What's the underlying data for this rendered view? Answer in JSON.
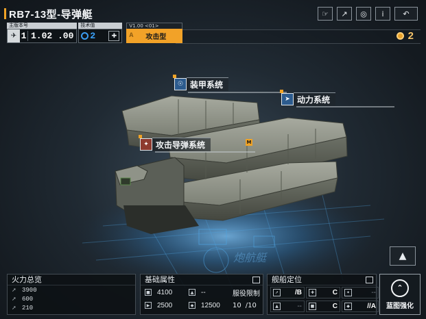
{
  "header": {
    "title": "RB7-13型-导弹艇",
    "icons": [
      "share-cursor-icon",
      "export-icon",
      "view-eye-icon",
      "info-icon",
      "back-icon"
    ]
  },
  "info": {
    "version_label": "主版本号",
    "version_major": "1",
    "version_minor": "1.02 .00",
    "tech_label": "技术值",
    "tech_value": "2",
    "type_tag": "V1.00 <01>",
    "type_letter": "A",
    "type_text": "攻击型"
  },
  "currency": {
    "value": "2",
    "icon": "coin-icon"
  },
  "systems": {
    "armor": "装甲系统",
    "power": "动力系统",
    "missile": "攻击导弹系统",
    "missile_badge": "M"
  },
  "watermark": "炮航艇",
  "fire_panel": {
    "title": "火力总览",
    "rows": [
      {
        "value": "3900"
      },
      {
        "value": "600"
      },
      {
        "value": "210"
      }
    ]
  },
  "base_panel": {
    "title": "基础属性",
    "armor_value": "4100",
    "shield_value": "--",
    "service_label": "服役限制",
    "speed_value": "2500",
    "range_value": "12500",
    "service_value": "10",
    "service_max": "/10"
  },
  "position_panel": {
    "title": "舰船定位",
    "row1": [
      {
        "grade": "/B"
      },
      {
        "grade": "C"
      },
      {
        "grade": "--"
      }
    ],
    "row2": [
      {
        "grade": "--"
      },
      {
        "grade": "C"
      },
      {
        "grade": "//A"
      }
    ]
  },
  "blueprint": {
    "label": "蓝图强化"
  },
  "colors": {
    "accent": "#f0a326",
    "tech_blue": "#3ba4ff",
    "panel_bg": "#0d1115"
  }
}
